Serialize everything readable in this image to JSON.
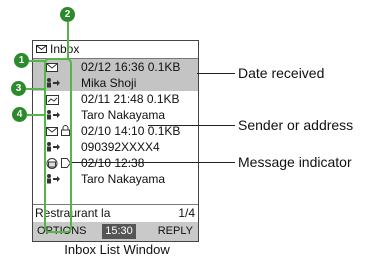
{
  "window": {
    "title": "Inbox"
  },
  "messages": [
    {
      "meta": "02/12 16:36 0.1KB",
      "from": "Mika Shoji",
      "selected": true
    },
    {
      "meta": "02/11 21:48 0.1KB",
      "from": "Taro Nakayama",
      "selected": false
    },
    {
      "meta": "02/10 14:10 0.1KB",
      "from": "090392XXXX4",
      "selected": false
    },
    {
      "meta": "02/10 12:38",
      "from": "Taro Nakayama",
      "selected": false
    }
  ],
  "status": {
    "text": "Restraurant la",
    "page": "1/4"
  },
  "softkeys": {
    "left": "OPTIONS",
    "clock": "15:30",
    "right": "REPLY"
  },
  "callouts": {
    "date_received": "Date received",
    "sender": "Sender or address",
    "indicator": "Message indicator"
  },
  "badges": [
    "1",
    "2",
    "3",
    "4"
  ],
  "caption": "Inbox List Window",
  "colors": {
    "highlight": "#55b548",
    "badge": "#2b8a2b",
    "selected_row": "#c4c4c4"
  },
  "icons": [
    "envelope-icon",
    "person-arrow-icon",
    "lock-icon",
    "tag-icon",
    "message-type-icon"
  ]
}
